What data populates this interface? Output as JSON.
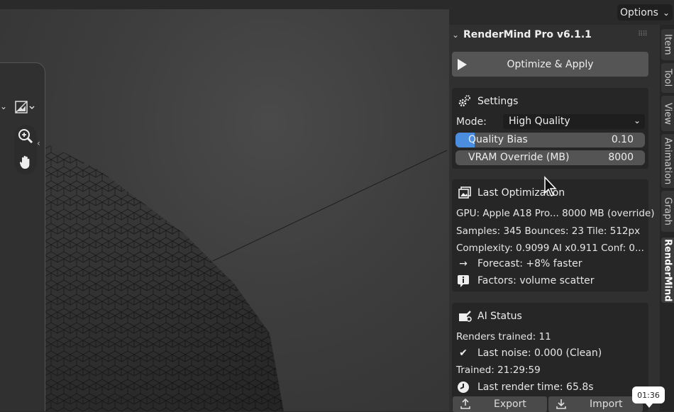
{
  "header": {
    "options_label": "Options"
  },
  "panel": {
    "title": "RenderMind Pro  v6.1.1",
    "optimize_label": "Optimize & Apply",
    "settings": {
      "title": "Settings",
      "mode_label": "Mode:",
      "mode_value": "High Quality",
      "quality_bias_label": "Quality Bias",
      "quality_bias_value": "0.10",
      "quality_bias_level": 0.1,
      "vram_label": "VRAM Override (MB)",
      "vram_value": "8000"
    },
    "last_optimization": {
      "title": "Last Optimization",
      "gpu": "GPU: Apple A18 Pro... 8000 MB (override)",
      "samples": "Samples: 345   Bounces: 23   Tile: 512px",
      "complexity": "Complexity: 0.9099   AI x0.911   Conf: 0...",
      "forecast": "Forecast: +8% faster",
      "factors": "Factors: volume scatter"
    },
    "ai_status": {
      "title": "AI Status",
      "renders_trained": "Renders trained: 11",
      "last_noise": "Last noise: 0.000  (Clean)",
      "trained": "Trained: 21:29:59",
      "last_render_time": "Last render time: 65.8s",
      "export_label": "Export",
      "import_label": "Import"
    }
  },
  "tabs": [
    {
      "label": "Item"
    },
    {
      "label": "Tool"
    },
    {
      "label": "View"
    },
    {
      "label": "Animation"
    },
    {
      "label": "Graph"
    },
    {
      "label": "RenderMind",
      "active": true
    }
  ],
  "timestamp_badge": "01:36",
  "colors": {
    "accent": "#4b8ee0",
    "panel_bg": "#303030",
    "box_bg": "#262626"
  }
}
